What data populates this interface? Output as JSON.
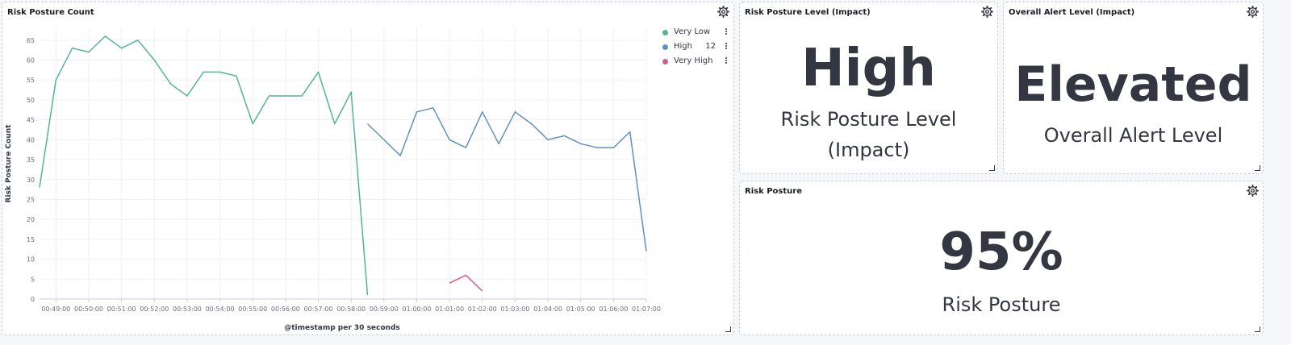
{
  "panels": {
    "risk_posture_count": {
      "title": "Risk Posture Count",
      "legend": [
        {
          "label": "Very Low",
          "value": "",
          "color": "#54b399"
        },
        {
          "label": "High",
          "value": "12",
          "color": "#6092c0"
        },
        {
          "label": "Very High",
          "value": "",
          "color": "#d36086"
        }
      ]
    },
    "risk_posture_level": {
      "title": "Risk Posture Level (Impact)",
      "value": "High",
      "label_line1": "Risk Posture Level",
      "label_line2": "(Impact)"
    },
    "overall_alert_level": {
      "title": "Overall Alert Level (Impact)",
      "value": "Elevated",
      "label": "Overall Alert Level"
    },
    "risk_posture": {
      "title": "Risk Posture",
      "value": "95%",
      "label": "Risk Posture"
    }
  },
  "chart_data": {
    "type": "line",
    "title": "Risk Posture Count",
    "xlabel": "@timestamp per 30 seconds",
    "ylabel": "Risk Posture Count",
    "ylim": [
      0,
      68
    ],
    "yticks": [
      0,
      5,
      10,
      15,
      20,
      25,
      30,
      35,
      40,
      45,
      50,
      55,
      60,
      65
    ],
    "x_ticks": [
      "00:49:00",
      "00:50:00",
      "00:51:00",
      "00:52:00",
      "00:53:00",
      "00:54:00",
      "00:55:00",
      "00:56:00",
      "00:57:00",
      "00:58:00",
      "00:59:00",
      "01:00:00",
      "01:01:00",
      "01:02:00",
      "01:03:00",
      "01:04:00",
      "01:05:00",
      "01:06:00",
      "01:07:00"
    ],
    "grid": true,
    "legend_position": "top-right",
    "series": [
      {
        "name": "Very Low",
        "color": "#54b399",
        "x": [
          "00:48:30",
          "00:49:00",
          "00:49:30",
          "00:50:00",
          "00:50:30",
          "00:51:00",
          "00:51:30",
          "00:52:00",
          "00:52:30",
          "00:53:00",
          "00:53:30",
          "00:54:00",
          "00:54:30",
          "00:55:00",
          "00:55:30",
          "00:56:00",
          "00:56:30",
          "00:57:00",
          "00:57:30",
          "00:58:00",
          "00:58:30"
        ],
        "y": [
          28,
          55,
          63,
          62,
          66,
          63,
          65,
          60,
          54,
          51,
          57,
          57,
          56,
          44,
          51,
          51,
          51,
          57,
          44,
          52,
          1
        ]
      },
      {
        "name": "High",
        "color": "#6092c0",
        "x": [
          "00:58:30",
          "00:59:00",
          "00:59:30",
          "01:00:00",
          "01:00:30",
          "01:01:00",
          "01:01:30",
          "01:02:00",
          "01:02:30",
          "01:03:00",
          "01:03:30",
          "01:04:00",
          "01:04:30",
          "01:05:00",
          "01:05:30",
          "01:06:00",
          "01:06:30",
          "01:07:00"
        ],
        "y": [
          44,
          40,
          36,
          47,
          48,
          40,
          38,
          47,
          39,
          47,
          44,
          40,
          41,
          39,
          38,
          38,
          42,
          12
        ]
      },
      {
        "name": "Very High",
        "color": "#d36086",
        "x": [
          "01:01:00",
          "01:01:30",
          "01:02:00"
        ],
        "y": [
          4,
          6,
          2
        ]
      }
    ]
  }
}
